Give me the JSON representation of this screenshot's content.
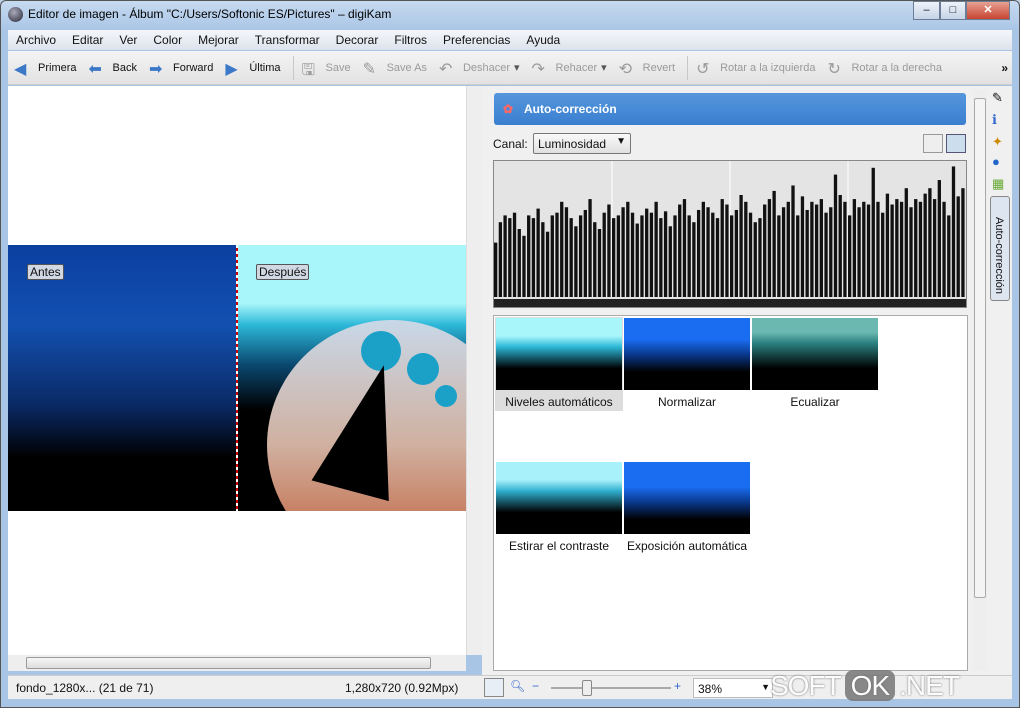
{
  "window": {
    "title": "Editor de imagen - Álbum \"C:/Users/Softonic ES/Pictures\" – digiKam"
  },
  "menu": [
    "Archivo",
    "Editar",
    "Ver",
    "Color",
    "Mejorar",
    "Transformar",
    "Decorar",
    "Filtros",
    "Preferencias",
    "Ayuda"
  ],
  "toolbar": {
    "primera": "Primera",
    "back": "Back",
    "forward": "Forward",
    "ultima": "Última",
    "save": "Save",
    "save_as": "Save As",
    "deshacer": "Deshacer",
    "rehacer": "Rehacer",
    "revert": "Revert",
    "rot_left": "Rotar a la izquierda",
    "rot_right": "Rotar a la derecha",
    "more": "»"
  },
  "preview": {
    "before": "Antes",
    "after": "Después"
  },
  "panel": {
    "title": "Auto-corrección",
    "canal_label": "Canal:",
    "canal_value": "Luminosidad",
    "tab_label": "Auto-corrección"
  },
  "histogram": [
    40,
    55,
    60,
    58,
    62,
    50,
    45,
    60,
    58,
    65,
    55,
    48,
    60,
    62,
    70,
    66,
    58,
    52,
    60,
    64,
    72,
    55,
    50,
    62,
    68,
    58,
    60,
    66,
    70,
    62,
    54,
    60,
    65,
    62,
    70,
    58,
    63,
    52,
    60,
    68,
    72,
    60,
    55,
    64,
    70,
    66,
    62,
    58,
    72,
    68,
    60,
    64,
    75,
    70,
    62,
    55,
    58,
    68,
    72,
    78,
    60,
    66,
    70,
    82,
    60,
    74,
    64,
    70,
    68,
    72,
    62,
    66,
    90,
    75,
    70,
    60,
    72,
    66,
    70,
    68,
    95,
    70,
    62,
    76,
    68,
    72,
    70,
    80,
    66,
    72,
    70,
    76,
    80,
    72,
    86,
    70,
    60,
    96,
    74,
    80
  ],
  "thumbnails": [
    {
      "label": "Niveles automáticos",
      "selected": true
    },
    {
      "label": "Normalizar"
    },
    {
      "label": "Ecualizar"
    },
    {
      "label": "Estirar el contraste"
    },
    {
      "label": "Exposición automática"
    }
  ],
  "status": {
    "file": "fondo_1280x... (21 de 71)",
    "size": "1,280x720 (0.92Mpx)",
    "zoom": "38%",
    "zoom_slider": 0.3
  },
  "watermark": "SOFT OK .NET"
}
